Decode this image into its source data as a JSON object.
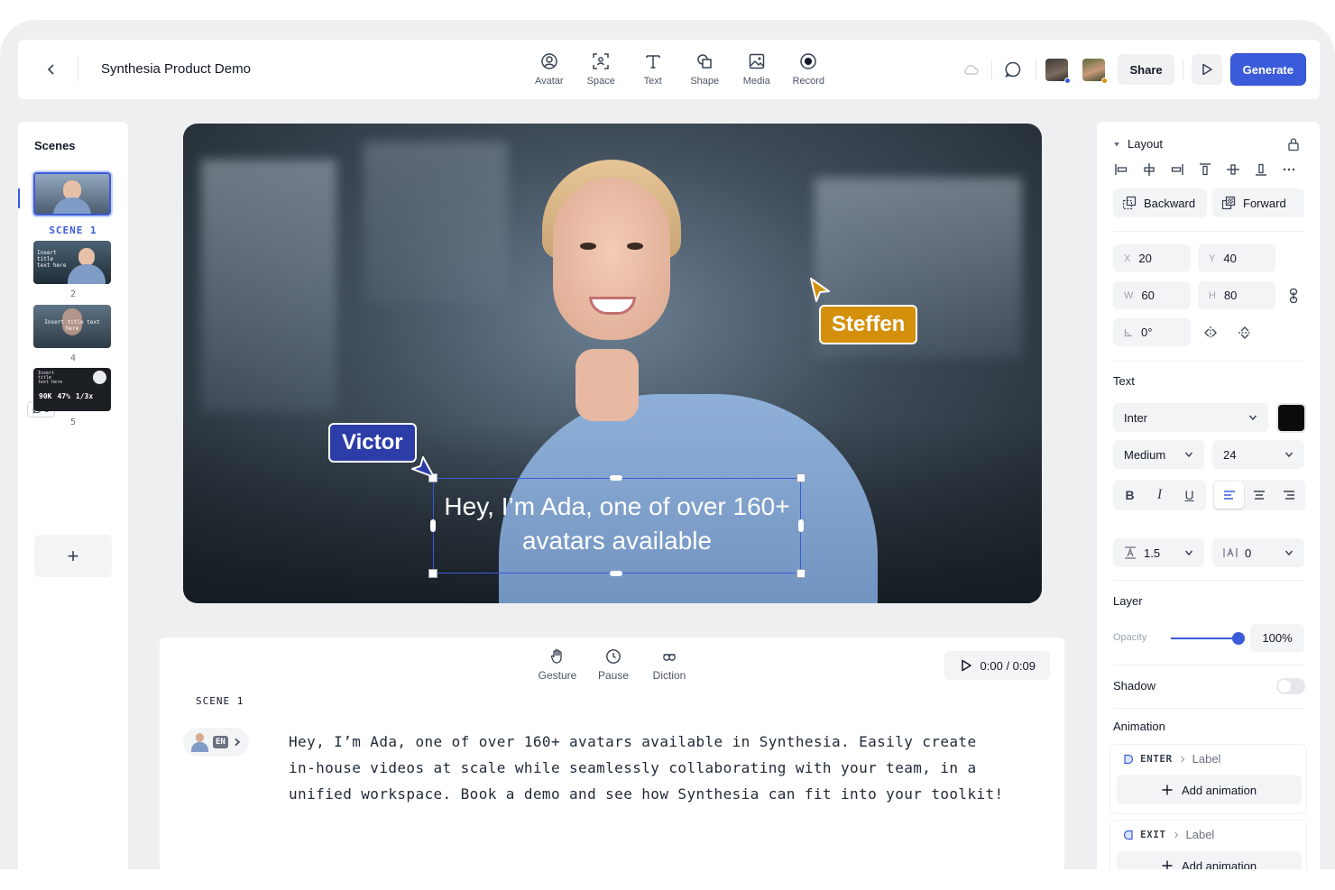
{
  "header": {
    "project_title": "Synthesia Product Demo",
    "tools": [
      {
        "label": "Avatar",
        "icon": "avatar-icon"
      },
      {
        "label": "Space",
        "icon": "space-icon"
      },
      {
        "label": "Text",
        "icon": "text-icon"
      },
      {
        "label": "Shape",
        "icon": "shape-icon"
      },
      {
        "label": "Media",
        "icon": "media-icon"
      },
      {
        "label": "Record",
        "icon": "record-icon"
      }
    ],
    "share_label": "Share",
    "generate_label": "Generate",
    "colors": {
      "accent": "#3b5bdb"
    }
  },
  "scenes": {
    "title": "Scenes",
    "items": [
      {
        "label": "SCENE 1"
      },
      {
        "label": "2",
        "thumb_text": "Insert title text here"
      },
      {
        "label": "4",
        "thumb_text": "Insert title text here",
        "comments": "3"
      },
      {
        "label": "5",
        "stats": [
          "90K",
          "47%",
          "1/3x"
        ],
        "thumb_text": "Insert title text here"
      }
    ],
    "add_label": "+"
  },
  "canvas": {
    "caption": "Hey, I’m Ada, one of over 160+ avatars available",
    "collaborators": [
      {
        "name": "Victor",
        "color": "#2d3da8"
      },
      {
        "name": "Steffen",
        "color": "#d4900a"
      }
    ]
  },
  "script": {
    "tools": [
      {
        "label": "Gesture",
        "icon": "gesture-icon"
      },
      {
        "label": "Pause",
        "icon": "clock-icon"
      },
      {
        "label": "Diction",
        "icon": "diction-icon"
      }
    ],
    "timer": "0:00 / 0:09",
    "scene_label": "SCENE 1",
    "language": "EN",
    "text": "Hey, I’m Ada, one of over 160+ avatars available in Synthesia. Easily create in-house videos at scale while seamlessly collaborating with your team, in a unified workspace. Book a demo and see how Synthesia can fit into your toolkit!"
  },
  "properties": {
    "layout": {
      "title": "Layout",
      "backward_label": "Backward",
      "forward_label": "Forward",
      "x": {
        "key": "X",
        "value": "20"
      },
      "y": {
        "key": "Y",
        "value": "40"
      },
      "w": {
        "key": "W",
        "value": "60"
      },
      "h": {
        "key": "H",
        "value": "80"
      },
      "rotation": "0°"
    },
    "text": {
      "title": "Text",
      "font": "Inter",
      "weight": "Medium",
      "size": "24",
      "bold": "B",
      "italic": "I",
      "underline": "U",
      "line_height": "1.5",
      "letter_spacing": "0",
      "color": "#0b0b0b"
    },
    "layer": {
      "title": "Layer",
      "opacity_label": "Opacity",
      "opacity_value": "100%",
      "opacity": 1.0
    },
    "shadow": {
      "title": "Shadow",
      "enabled": false
    },
    "animation": {
      "title": "Animation",
      "enter": {
        "type": "ENTER",
        "label": "Label",
        "add": "Add animation"
      },
      "exit": {
        "type": "EXIT",
        "label": "Label",
        "add": "Add animation"
      }
    }
  }
}
